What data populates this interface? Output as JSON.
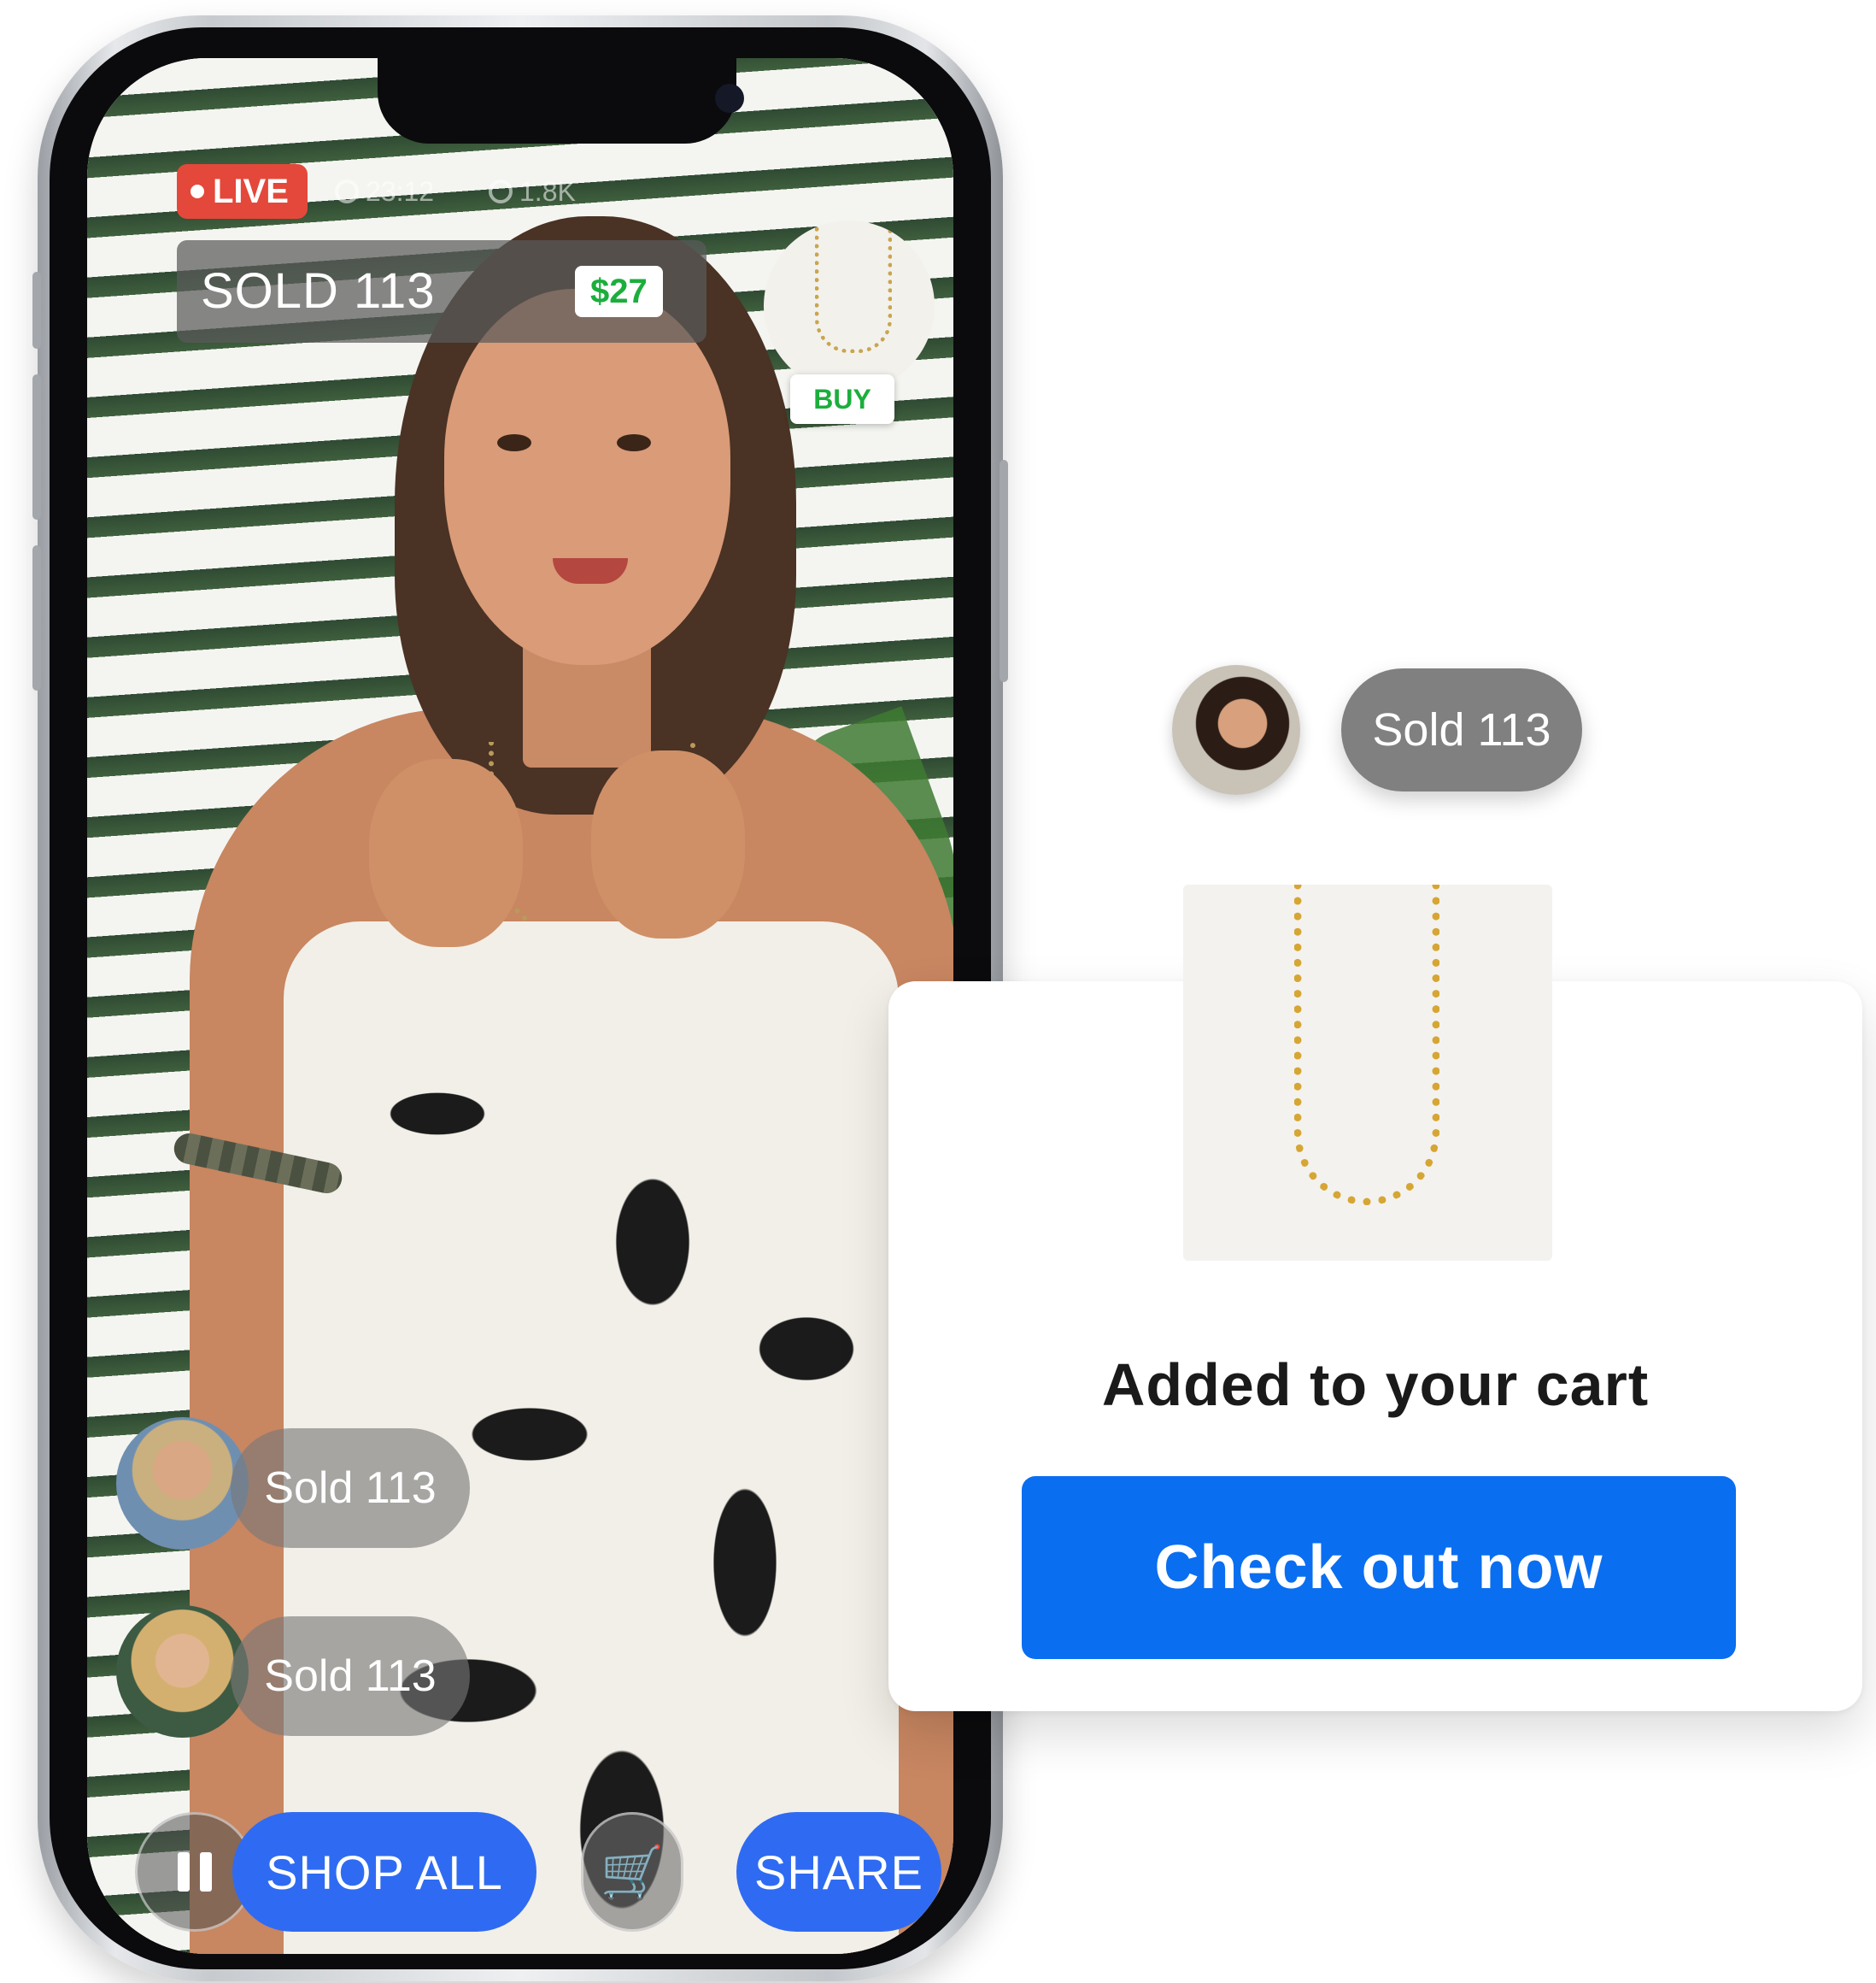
{
  "phone": {
    "live_badge": "LIVE",
    "duration": "23:12",
    "viewers": "1.8K",
    "sold_banner": "SOLD 113",
    "price": "$27",
    "buy_label": "BUY",
    "feed": [
      {
        "text": "Sold 113"
      },
      {
        "text": "Sold 113"
      }
    ],
    "controls": {
      "shop_all_label": "SHOP ALL",
      "share_label": "SHARE"
    }
  },
  "notification": {
    "text": "Sold 113"
  },
  "cart": {
    "title": "Added to your cart",
    "checkout_label": "Check out now"
  },
  "colors": {
    "live_red": "#e4483a",
    "price_green": "#1cae3c",
    "shop_blue": "#2f6bf2",
    "checkout_blue": "#0a6ef0"
  }
}
